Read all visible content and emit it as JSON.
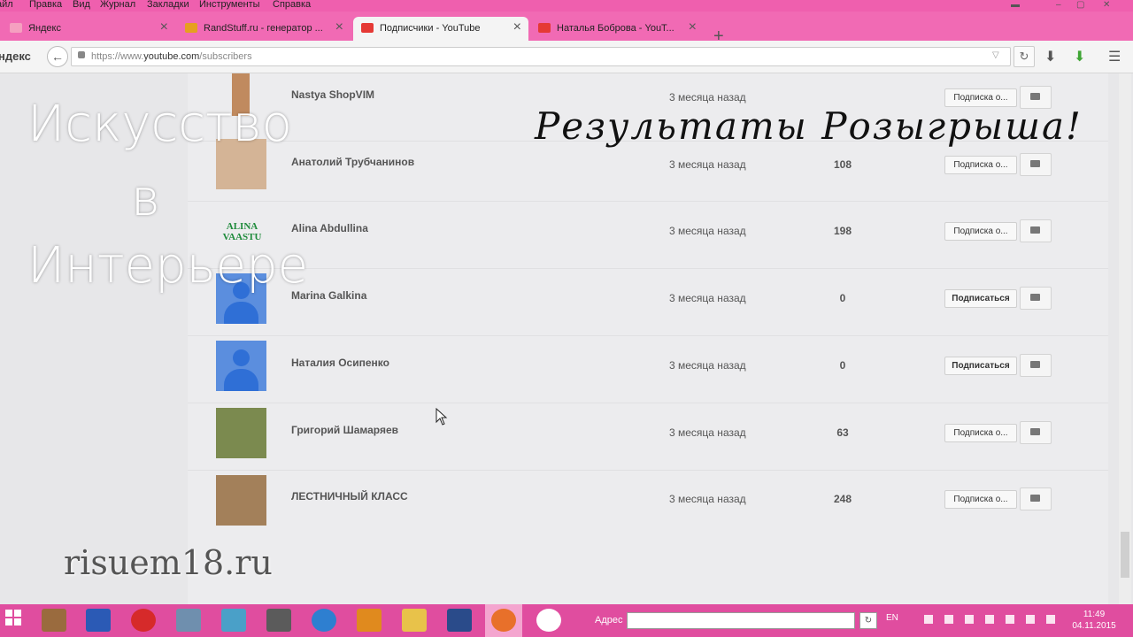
{
  "menu": [
    "айл",
    "Правка",
    "Вид",
    "Журнал",
    "Закладки",
    "Инструменты",
    "Справка"
  ],
  "tabs": [
    {
      "label": "Яндекс",
      "color": "#f5a0c0"
    },
    {
      "label": "RandStuff.ru - генератор ...",
      "color": "#e6a020"
    },
    {
      "label": "Подписчики - YouTube",
      "color": "#e53935"
    },
    {
      "label": "Наталья Боброва - YouT...",
      "color": "#e53935"
    }
  ],
  "nav": {
    "brand": "ндекс",
    "url_prefix": "https://www.",
    "url_host": "youtube.com",
    "url_path": "/subscribers"
  },
  "subscribers": [
    {
      "name": "Nastya ShopVIM",
      "date": "3 месяца назад",
      "count": "",
      "button": "Подписка о...",
      "subscribed": true
    },
    {
      "name": "Анатолий Трубчанинов",
      "date": "3 месяца назад",
      "count": "108",
      "button": "Подписка о...",
      "subscribed": true
    },
    {
      "name": "Alina Abdullina",
      "date": "3 месяца назад",
      "count": "198",
      "button": "Подписка о...",
      "subscribed": true,
      "logo": "ALINA VAASTU"
    },
    {
      "name": "Marina Galkina",
      "date": "3 месяца назад",
      "count": "0",
      "button": "Подписаться",
      "subscribed": false
    },
    {
      "name": "Наталия Осипенко",
      "date": "3 месяца назад",
      "count": "0",
      "button": "Подписаться",
      "subscribed": false
    },
    {
      "name": "Григорий Шамаряев",
      "date": "3 месяца назад",
      "count": "63",
      "button": "Подписка о...",
      "subscribed": true
    },
    {
      "name": "ЛЕСТНИЧНЫЙ КЛАСС",
      "date": "3 месяца назад",
      "count": "248",
      "button": "Подписка о...",
      "subscribed": true
    }
  ],
  "overlay": {
    "line1": "Искусство",
    "line2": "в",
    "line3": "Интерьере",
    "title": "Результаты Розыгрыша!",
    "brand": "risuem18.ru"
  },
  "taskbar": {
    "address_label": "Адрес",
    "lang": "EN",
    "time": "11:49",
    "date": "04.11.2015"
  }
}
